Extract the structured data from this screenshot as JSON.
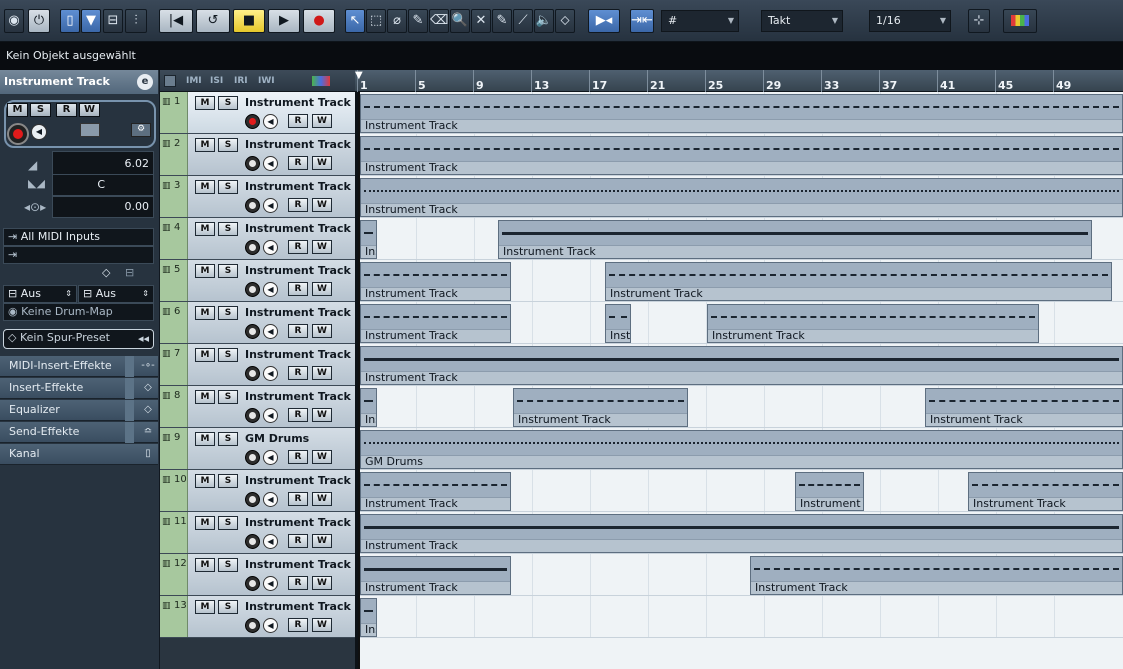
{
  "toolbar": {
    "transport": {
      "rewind": "|◀",
      "forward": "▶|",
      "cycle": "↺",
      "stop": "■",
      "play": "▶",
      "record": "●"
    },
    "tools": [
      "↖",
      "⬚",
      "⌀",
      "✎",
      "⌫",
      "🔍",
      "✕",
      "✎",
      "⟋",
      "🔈",
      "⬦"
    ],
    "grid_type": "Takt",
    "quantize": "1/16",
    "snap_icon": "#"
  },
  "info_line": {
    "text": "Kein Objekt ausgewählt"
  },
  "inspector": {
    "title": "Instrument Track",
    "edit_icon": "e",
    "buttons": {
      "mute": "M",
      "solo": "S",
      "read": "R",
      "write": "W"
    },
    "volume": "6.02",
    "pan": "C",
    "delay": "0.00",
    "midi_input": "All MIDI Inputs",
    "midi_output": "",
    "channel_left": "Aus",
    "channel_right": "Aus",
    "drum_map": "Keine Drum-Map",
    "track_preset": "Kein Spur-Preset",
    "sections": [
      {
        "label": "MIDI-Insert-Effekte",
        "icon": "-∘-"
      },
      {
        "label": "Insert-Effekte",
        "icon": "◇"
      },
      {
        "label": "Equalizer",
        "icon": "◇"
      },
      {
        "label": "Send-Effekte",
        "icon": "≏"
      },
      {
        "label": "Kanal",
        "icon": "▯"
      }
    ]
  },
  "tracklist_header": {
    "icons": [
      "IMI",
      "ISI",
      "IRI",
      "IWI"
    ]
  },
  "ruler": {
    "bars": [
      "1",
      "5",
      "9",
      "13",
      "17",
      "21",
      "25",
      "29",
      "33",
      "37",
      "41",
      "45",
      "49"
    ]
  },
  "tracks": [
    {
      "number": "1",
      "name": "Instrument Track",
      "selected": true,
      "record": true,
      "parts": [
        {
          "label": "Instrument Track",
          "style": "dashed",
          "start": 0,
          "end": 1.0
        }
      ]
    },
    {
      "number": "2",
      "name": "Instrument Track",
      "parts": [
        {
          "label": "Instrument Track",
          "style": "dashed",
          "start": 0,
          "end": 1.0
        }
      ]
    },
    {
      "number": "3",
      "name": "Instrument Track",
      "parts": [
        {
          "label": "Instrument Track",
          "style": "dots",
          "start": 0,
          "end": 1.0
        }
      ]
    },
    {
      "number": "4",
      "name": "Instrument Track",
      "parts": [
        {
          "label": "Ins",
          "style": "dashed",
          "start": 0,
          "end": 0.025
        },
        {
          "label": "Instrument Track",
          "style": "dense",
          "start": 0.181,
          "end": 0.96
        }
      ]
    },
    {
      "number": "5",
      "name": "Instrument Track",
      "parts": [
        {
          "label": "Instrument Track",
          "style": "dashed",
          "start": 0,
          "end": 0.2
        },
        {
          "label": "Instrument Track",
          "style": "dashed",
          "start": 0.32,
          "end": 0.985
        }
      ]
    },
    {
      "number": "6",
      "name": "Instrument Track",
      "parts": [
        {
          "label": "Instrument Track",
          "style": "dashed",
          "start": 0,
          "end": 0.2
        },
        {
          "label": "Instr",
          "style": "dashed",
          "start": 0.32,
          "end": 0.357
        },
        {
          "label": "Instrument Track",
          "style": "dashed",
          "start": 0.453,
          "end": 0.89
        }
      ]
    },
    {
      "number": "7",
      "name": "Instrument Track",
      "parts": [
        {
          "label": "Instrument Track",
          "style": "dense",
          "start": 0,
          "end": 1.0
        }
      ]
    },
    {
      "number": "8",
      "name": "Instrument Track",
      "parts": [
        {
          "label": "Ins",
          "style": "dashed",
          "start": 0,
          "end": 0.025
        },
        {
          "label": "Instrument Track",
          "style": "dashed",
          "start": 0.2,
          "end": 0.432
        },
        {
          "label": "Instrument Track",
          "style": "dashed",
          "start": 0.738,
          "end": 1.0
        }
      ]
    },
    {
      "number": "9",
      "name": "GM Drums",
      "parts": [
        {
          "label": "GM Drums",
          "style": "dots",
          "start": 0,
          "end": 1.0
        }
      ]
    },
    {
      "number": "10",
      "name": "Instrument Track",
      "parts": [
        {
          "label": "Instrument Track",
          "style": "dashed",
          "start": 0,
          "end": 0.2
        },
        {
          "label": "Instrument Tr",
          "style": "dashed",
          "start": 0.568,
          "end": 0.662
        },
        {
          "label": "Instrument Track",
          "style": "dashed",
          "start": 0.795,
          "end": 1.0
        }
      ]
    },
    {
      "number": "11",
      "name": "Instrument Track",
      "parts": [
        {
          "label": "Instrument Track",
          "style": "dense",
          "start": 0,
          "end": 1.0
        }
      ]
    },
    {
      "number": "12",
      "name": "Instrument Track",
      "parts": [
        {
          "label": "Instrument Track",
          "style": "dense",
          "start": 0,
          "end": 0.2
        },
        {
          "label": "Instrument Track",
          "style": "dashed",
          "start": 0.51,
          "end": 1.0
        }
      ]
    },
    {
      "number": "13",
      "name": "Instrument Track",
      "parts": [
        {
          "label": "Ins",
          "style": "dashed",
          "start": 0,
          "end": 0.025
        }
      ]
    }
  ],
  "colors": {
    "track_color": "#a7c89e",
    "part_fill": "#9fafc0",
    "record_red": "#e21b1b",
    "accent_blue": "#3b67a8"
  }
}
